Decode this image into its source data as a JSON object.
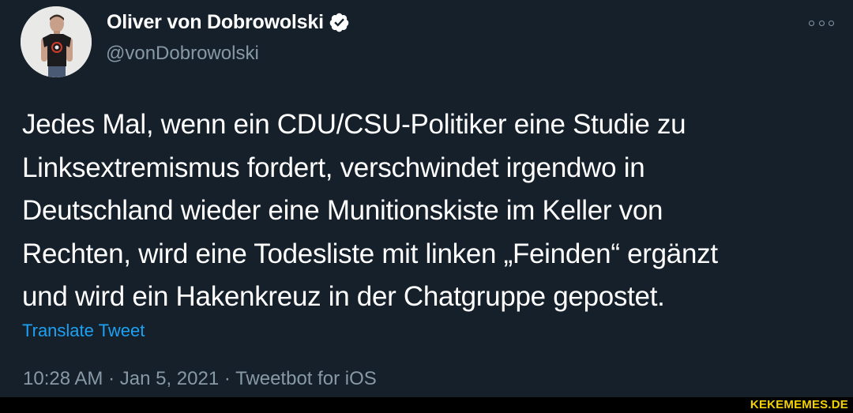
{
  "user": {
    "display_name": "Oliver von Dobrowolski",
    "handle": "@vonDobrowolski",
    "verified": true
  },
  "tweet": {
    "text": "Jedes Mal, wenn ein CDU/CSU-Politiker eine Studie zu\nLinksextremismus fordert, verschwindet irgendwo in\nDeutschland wieder eine Munitionskiste im Keller von\nRechten, wird eine Todesliste mit linken „Feinden“ ergänzt\nund wird ein Hakenkreuz in der Chatgruppe gepostet.",
    "translate_label": "Translate Tweet",
    "meta": "10:28 AM · Jan 5, 2021 · Tweetbot for iOS"
  },
  "watermark": "KEKEMEMES.DE",
  "icons": {
    "verified": "verified-badge-icon",
    "more": "more-options-icon"
  },
  "colors": {
    "background": "#15202b",
    "secondary_text": "#8899a6",
    "link": "#1da1f2",
    "watermark": "#f2d200"
  }
}
